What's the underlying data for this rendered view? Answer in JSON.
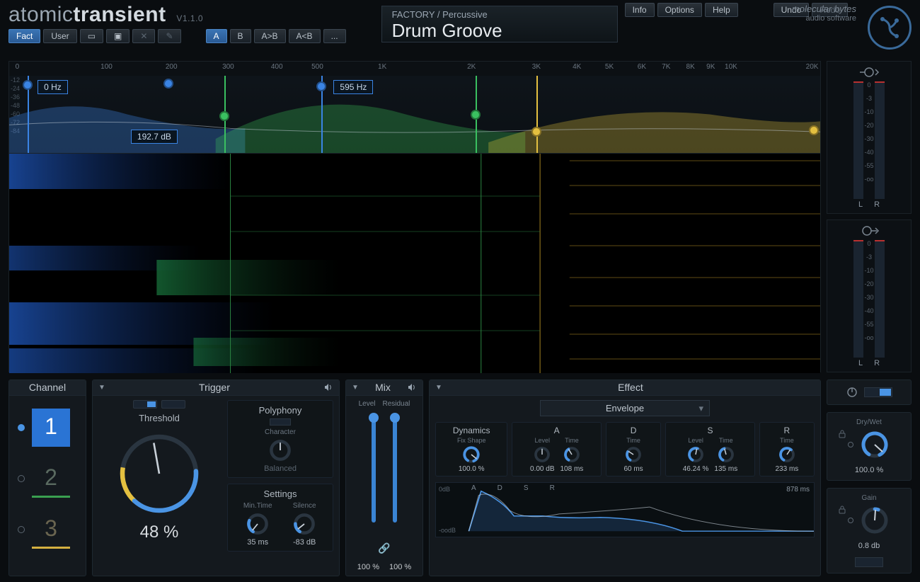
{
  "brand": {
    "light": "atomic",
    "bold": "transient",
    "version": "V1.1.0"
  },
  "company": {
    "name": "molecular bytes",
    "sub": "audio software"
  },
  "toolbar": {
    "fact": "Fact",
    "user": "User",
    "a": "A",
    "b": "B",
    "a2b": "A>B",
    "b2a": "A<B",
    "more": "...",
    "info": "Info",
    "options": "Options",
    "help": "Help",
    "undo": "Undo",
    "redo": "Redo"
  },
  "preset": {
    "path": "FACTORY / Percussive",
    "name": "Drum Groove"
  },
  "freq_ticks": [
    {
      "l": "0",
      "p": 1
    },
    {
      "l": "100",
      "p": 12
    },
    {
      "l": "200",
      "p": 20
    },
    {
      "l": "300",
      "p": 27
    },
    {
      "l": "400",
      "p": 33
    },
    {
      "l": "500",
      "p": 38
    },
    {
      "l": "1K",
      "p": 46
    },
    {
      "l": "2K",
      "p": 57
    },
    {
      "l": "3K",
      "p": 65
    },
    {
      "l": "4K",
      "p": 70
    },
    {
      "l": "5K",
      "p": 74
    },
    {
      "l": "6K",
      "p": 78
    },
    {
      "l": "7K",
      "p": 81
    },
    {
      "l": "8K",
      "p": 84
    },
    {
      "l": "9K",
      "p": 86.5
    },
    {
      "l": "10K",
      "p": 89
    },
    {
      "l": "20K",
      "p": 99
    }
  ],
  "db_ticks": [
    "-12",
    "-24",
    "-36",
    "-48",
    "-60",
    "-72",
    "-84"
  ],
  "bands": {
    "blue": {
      "freq_tag": "0 Hz",
      "db_tag": "192.7 dB"
    },
    "green": {
      "freq_tag": "595 Hz"
    }
  },
  "meter": {
    "ticks": [
      "0",
      "-3",
      "-10",
      "-20",
      "-30",
      "-40",
      "-55",
      "-oo"
    ],
    "L": "L",
    "R": "R"
  },
  "channel": {
    "title": "Channel",
    "items": [
      {
        "n": "1",
        "sel": true,
        "on": true
      },
      {
        "n": "2",
        "sel": false,
        "on": false,
        "cls": "g"
      },
      {
        "n": "3",
        "sel": false,
        "on": false,
        "cls": "y"
      }
    ]
  },
  "trigger": {
    "title": "Trigger",
    "threshold_label": "Threshold",
    "threshold_val": "48 %",
    "polyphony": {
      "title": "Polyphony",
      "char_label": "Character",
      "char_sub": "Balanced"
    },
    "settings": {
      "title": "Settings",
      "mintime_label": "Min.Time",
      "mintime_val": "35 ms",
      "silence_label": "Silence",
      "silence_val": "-83 dB"
    }
  },
  "mix": {
    "title": "Mix",
    "level_label": "Level",
    "residual_label": "Residual",
    "level_val": "100 %",
    "residual_val": "100 %"
  },
  "effect": {
    "title": "Effect",
    "selected": "Envelope",
    "dynamics": {
      "title": "Dynamics",
      "sub": "Fix Shape",
      "val": "100.0 %"
    },
    "A": {
      "title": "A",
      "level_l": "Level",
      "level_v": "0.00 dB",
      "time_l": "Time",
      "time_v": "108 ms"
    },
    "D": {
      "title": "D",
      "time_l": "Time",
      "time_v": "60 ms"
    },
    "S": {
      "title": "S",
      "level_l": "Level",
      "level_v": "46.24 %",
      "time_l": "Time",
      "time_v": "135 ms"
    },
    "R": {
      "title": "R",
      "time_l": "Time",
      "time_v": "233 ms"
    },
    "graph": {
      "top": "0dB",
      "bottom": "-oodB",
      "len": "878 ms",
      "marks": [
        "A",
        "D",
        "S",
        "R"
      ]
    }
  },
  "right": {
    "drywet_label": "Dry/Wet",
    "drywet_val": "100.0 %",
    "gain_label": "Gain",
    "gain_val": "0.8 db"
  }
}
